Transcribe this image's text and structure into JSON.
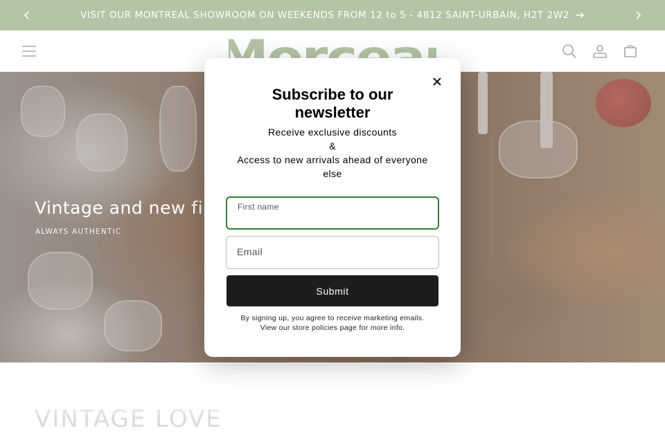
{
  "announcement": {
    "text": "VISIT OUR MONTREAL SHOWROOM ON WEEKENDS FROM 12 to 5 - 4812 SAINT-URBAIN, H2T 2W2",
    "bg_color": "#9bb189"
  },
  "header": {
    "logo_text": "Morceau",
    "brand_color": "#9bb189",
    "icons": [
      "menu-icon",
      "search-icon",
      "account-icon",
      "cart-icon"
    ]
  },
  "hero": {
    "title": "Vintage and new fine",
    "subtitle": "ALWAYS AUTHENTIC"
  },
  "below": {
    "heading": "VINTAGE LOVE"
  },
  "modal": {
    "title_line1": "Subscribe to our",
    "title_line2": "newsletter",
    "desc_line1": "Receive exclusive discounts",
    "desc_line2": "&",
    "desc_line3": "Access to new arrivals ahead of everyone",
    "desc_line4": "else",
    "first_name_label": "First name",
    "email_label": "Email",
    "submit_label": "Submit",
    "legal_line1": "By signing up, you agree to receive marketing emails.",
    "legal_line2": "View our store policies page for more info.",
    "focus_color": "#2f7d32",
    "button_color": "#1c1d1f"
  }
}
